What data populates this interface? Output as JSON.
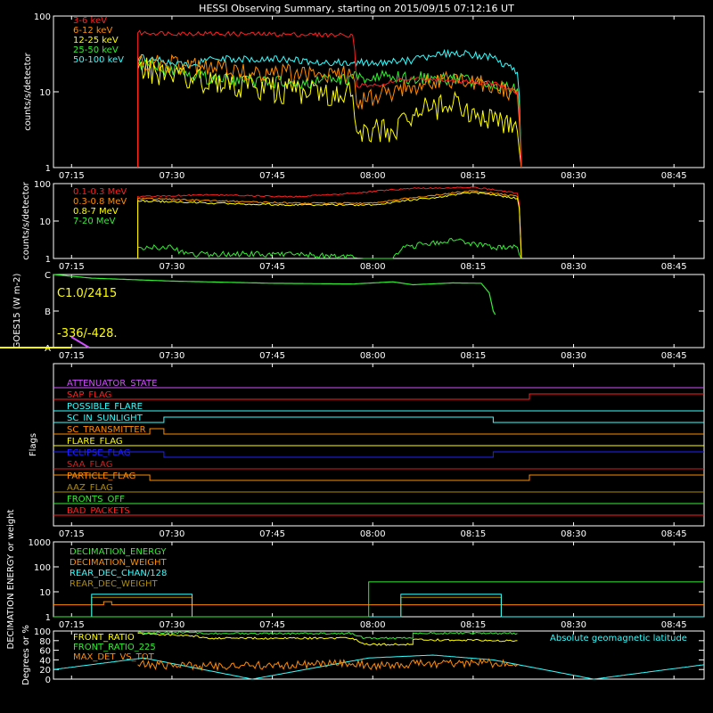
{
  "title": "HESSI Observing Summary, starting on 2015/09/15 07:12:16 UT",
  "time_ticks": [
    "07:15",
    "07:30",
    "07:45",
    "08:00",
    "08:15",
    "08:30",
    "08:45"
  ],
  "colors": {
    "red": "#ff2020",
    "orange": "#ff8c00",
    "yellow": "#ffff00",
    "green": "#33ee33",
    "cyan": "#33ffff",
    "blue": "#2020ff",
    "magenta": "#d050ff",
    "olive": "#b08c00",
    "darkred": "#d02020",
    "white": "#ffffff"
  },
  "chart_data": [
    {
      "type": "line",
      "ylabel": "counts/s/detector",
      "yscale": "log",
      "ylim": [
        1,
        100
      ],
      "yticks": [
        "1",
        "10",
        "100"
      ],
      "legend_placement": "top-left",
      "series": [
        {
          "name": "3-6 keV",
          "color": "red",
          "points": [
            [
              7.415,
              1
            ],
            [
              7.415,
              60
            ],
            [
              7.95,
              56
            ],
            [
              7.96,
              12
            ],
            [
              8.0,
              12
            ],
            [
              8.1,
              15
            ],
            [
              8.3,
              13
            ],
            [
              8.36,
              10
            ],
            [
              8.37,
              1
            ]
          ]
        },
        {
          "name": "6-12 keV",
          "color": "orange",
          "points": [
            [
              7.415,
              1
            ],
            [
              7.415,
              25
            ],
            [
              7.7,
              18
            ],
            [
              7.95,
              17
            ],
            [
              7.96,
              7
            ],
            [
              8.1,
              12
            ],
            [
              8.2,
              14
            ],
            [
              8.3,
              12
            ],
            [
              8.36,
              9
            ],
            [
              8.37,
              1
            ]
          ]
        },
        {
          "name": "12-25 keV",
          "color": "yellow",
          "points": [
            [
              7.415,
              1
            ],
            [
              7.415,
              20
            ],
            [
              7.6,
              13
            ],
            [
              7.8,
              10
            ],
            [
              7.95,
              9
            ],
            [
              7.96,
              3
            ],
            [
              8.05,
              3
            ],
            [
              8.1,
              5
            ],
            [
              8.2,
              7
            ],
            [
              8.3,
              4
            ],
            [
              8.36,
              3
            ],
            [
              8.37,
              1
            ]
          ]
        },
        {
          "name": "25-50 keV",
          "color": "green",
          "points": [
            [
              7.415,
              1
            ],
            [
              7.415,
              22
            ],
            [
              7.6,
              15
            ],
            [
              7.8,
              13
            ],
            [
              7.95,
              15
            ],
            [
              8.05,
              16
            ],
            [
              8.15,
              15
            ],
            [
              8.25,
              14
            ],
            [
              8.36,
              11
            ],
            [
              8.37,
              1
            ]
          ]
        },
        {
          "name": "50-100 keV",
          "color": "cyan",
          "points": [
            [
              7.415,
              1
            ],
            [
              7.415,
              28
            ],
            [
              7.55,
              22
            ],
            [
              7.6,
              28
            ],
            [
              7.8,
              26
            ],
            [
              7.95,
              24
            ],
            [
              8.1,
              26
            ],
            [
              8.2,
              33
            ],
            [
              8.3,
              28
            ],
            [
              8.36,
              18
            ],
            [
              8.37,
              1
            ]
          ]
        }
      ]
    },
    {
      "type": "line",
      "ylabel": "counts/s/detector",
      "yscale": "log",
      "ylim": [
        1,
        100
      ],
      "yticks": [
        "1",
        "10",
        "100"
      ],
      "legend_placement": "top-left",
      "series": [
        {
          "name": "0.1-0.3 MeV",
          "color": "red",
          "points": [
            [
              7.415,
              1
            ],
            [
              7.415,
              45
            ],
            [
              7.6,
              50
            ],
            [
              7.8,
              44
            ],
            [
              7.95,
              55
            ],
            [
              8.1,
              75
            ],
            [
              8.25,
              80
            ],
            [
              8.36,
              55
            ],
            [
              8.37,
              1
            ]
          ]
        },
        {
          "name": "0.3-0.8 MeV",
          "color": "orange",
          "points": [
            [
              7.415,
              1
            ],
            [
              7.415,
              40
            ],
            [
              7.6,
              35
            ],
            [
              7.8,
              30
            ],
            [
              8.0,
              30
            ],
            [
              8.15,
              48
            ],
            [
              8.25,
              65
            ],
            [
              8.36,
              45
            ],
            [
              8.37,
              1
            ]
          ]
        },
        {
          "name": "0.8-7 MeV",
          "color": "yellow",
          "points": [
            [
              7.415,
              1
            ],
            [
              7.415,
              35
            ],
            [
              7.6,
              30
            ],
            [
              7.8,
              27
            ],
            [
              8.0,
              27
            ],
            [
              8.15,
              42
            ],
            [
              8.25,
              58
            ],
            [
              8.36,
              40
            ],
            [
              8.37,
              1
            ]
          ]
        },
        {
          "name": "7-20 MeV",
          "color": "green",
          "points": [
            [
              7.415,
              1
            ],
            [
              7.415,
              2
            ],
            [
              7.5,
              2
            ],
            [
              7.53,
              1.3
            ],
            [
              7.8,
              1.3
            ],
            [
              7.98,
              1
            ],
            [
              8.05,
              1
            ],
            [
              8.08,
              2
            ],
            [
              8.2,
              3
            ],
            [
              8.3,
              2
            ],
            [
              8.36,
              2
            ],
            [
              8.37,
              1
            ]
          ]
        }
      ]
    },
    {
      "type": "line",
      "ylabel": "GOES15 (W m-2)",
      "yscale": "log",
      "yticks": [
        "A",
        "B",
        "C"
      ],
      "annotations": [
        "C1.0/2415",
        "-336/-428."
      ],
      "series": [
        {
          "name": "GOES15",
          "color": "green",
          "points": [
            [
              7.205,
              3.0
            ],
            [
              7.3,
              2.9
            ],
            [
              7.5,
              2.82
            ],
            [
              7.75,
              2.76
            ],
            [
              7.95,
              2.74
            ],
            [
              8.05,
              2.8
            ],
            [
              8.1,
              2.72
            ],
            [
              8.2,
              2.77
            ],
            [
              8.27,
              2.76
            ],
            [
              8.29,
              2.5
            ],
            [
              8.3,
              2.0
            ],
            [
              8.305,
              1.9
            ]
          ]
        }
      ]
    },
    {
      "type": "line",
      "ylabel": "Flags",
      "series": [
        {
          "name": "ATTENUATOR_STATE",
          "color": "magenta",
          "segments": [
            [
              7.205,
              8.825,
              0
            ]
          ]
        },
        {
          "name": "SAP_FLAG",
          "color": "red",
          "segments": [
            [
              7.205,
              8.39,
              0
            ],
            [
              8.39,
              8.825,
              1
            ]
          ]
        },
        {
          "name": "POSSIBLE_FLARE",
          "color": "cyan",
          "segments": [
            [
              7.205,
              8.825,
              0
            ]
          ]
        },
        {
          "name": "SC_IN_SUNLIGHT",
          "color": "cyan",
          "segments": [
            [
              7.205,
              7.48,
              0
            ],
            [
              7.48,
              8.3,
              1
            ],
            [
              8.3,
              8.825,
              0
            ]
          ]
        },
        {
          "name": "SC_TRANSMITTER",
          "color": "orange",
          "segments": [
            [
              7.205,
              7.445,
              0
            ],
            [
              7.445,
              7.48,
              1
            ],
            [
              7.48,
              8.825,
              0
            ]
          ]
        },
        {
          "name": "FLARE_FLAG",
          "color": "yellow",
          "segments": [
            [
              7.205,
              8.825,
              0
            ]
          ]
        },
        {
          "name": "ECLIPSE_FLAG",
          "color": "blue",
          "segments": [
            [
              7.205,
              7.48,
              1
            ],
            [
              7.48,
              8.3,
              0
            ],
            [
              8.3,
              8.825,
              1
            ]
          ]
        },
        {
          "name": "SAA_FLAG",
          "color": "darkred",
          "segments": [
            [
              7.205,
              8.825,
              0
            ]
          ]
        },
        {
          "name": "PARTICLE_FLAG",
          "color": "orange",
          "segments": [
            [
              7.205,
              7.445,
              1
            ],
            [
              7.445,
              8.39,
              0
            ],
            [
              8.39,
              8.825,
              1
            ]
          ]
        },
        {
          "name": "AAZ_FLAG",
          "color": "olive",
          "segments": [
            [
              7.205,
              8.825,
              0
            ]
          ]
        },
        {
          "name": "FRONTS_OFF",
          "color": "green",
          "segments": [
            [
              7.205,
              8.825,
              0
            ]
          ]
        },
        {
          "name": "BAD_PACKETS",
          "color": "red",
          "segments": [
            [
              7.205,
              8.825,
              0
            ]
          ]
        }
      ]
    },
    {
      "type": "line",
      "ylabel": "DECIMATION ENERGY or weight",
      "yscale": "log",
      "ylim": [
        1,
        1000
      ],
      "yticks": [
        "1",
        "10",
        "100",
        "1000"
      ],
      "legend_placement": "top-left",
      "series": [
        {
          "name": "DECIMATION_ENERGY",
          "color": "green",
          "points": [
            [
              7.205,
              1
            ],
            [
              7.99,
              1
            ],
            [
              7.99,
              25
            ],
            [
              8.825,
              25
            ]
          ]
        },
        {
          "name": "DECIMATION_WEIGHT",
          "color": "orange",
          "points": [
            [
              7.205,
              3
            ],
            [
              7.33,
              3
            ],
            [
              7.33,
              4
            ],
            [
              7.35,
              4
            ],
            [
              7.35,
              3
            ],
            [
              8.825,
              3
            ]
          ]
        },
        {
          "name": "REAR_DEC_CHAN/128",
          "color": "cyan",
          "points": [
            [
              7.205,
              1
            ],
            [
              7.3,
              1
            ],
            [
              7.3,
              8
            ],
            [
              7.55,
              8
            ],
            [
              7.55,
              1
            ],
            [
              8.07,
              1
            ],
            [
              8.07,
              8
            ],
            [
              8.32,
              8
            ],
            [
              8.32,
              1
            ],
            [
              8.825,
              1
            ]
          ]
        },
        {
          "name": "REAR_DEC_WEIGHT",
          "color": "olive",
          "points": [
            [
              7.205,
              1
            ],
            [
              7.3,
              1
            ],
            [
              7.3,
              6
            ],
            [
              7.55,
              6
            ],
            [
              7.55,
              1
            ],
            [
              8.07,
              1
            ],
            [
              8.07,
              6
            ],
            [
              8.32,
              6
            ],
            [
              8.32,
              1
            ],
            [
              8.825,
              1
            ]
          ]
        }
      ]
    },
    {
      "type": "line",
      "ylabel": "Degrees or %",
      "ylim": [
        0,
        100
      ],
      "yticks": [
        "0",
        "20",
        "40",
        "60",
        "80",
        "100"
      ],
      "legend_placement": "top-left",
      "annotations": [
        "Absolute geomagnetic latitude"
      ],
      "series": [
        {
          "name": "FRONT_RATIO",
          "color": "yellow",
          "points": [
            [
              7.415,
              95
            ],
            [
              7.55,
              90
            ],
            [
              7.6,
              85
            ],
            [
              7.95,
              85
            ],
            [
              7.98,
              72
            ],
            [
              8.1,
              72
            ],
            [
              8.1,
              82
            ],
            [
              8.36,
              80
            ]
          ]
        },
        {
          "name": "FRONT_RATIO_225",
          "color": "green",
          "points": [
            [
              7.415,
              97
            ],
            [
              7.55,
              97
            ],
            [
              7.6,
              95
            ],
            [
              7.95,
              95
            ],
            [
              7.98,
              85
            ],
            [
              8.1,
              85
            ],
            [
              8.1,
              96
            ],
            [
              8.36,
              95
            ]
          ]
        },
        {
          "name": "MAX_DET_VS_TOT",
          "color": "orange",
          "points": [
            [
              7.415,
              30
            ],
            [
              7.6,
              28
            ],
            [
              7.8,
              30
            ],
            [
              7.95,
              32
            ],
            [
              8.0,
              28
            ],
            [
              8.15,
              32
            ],
            [
              8.25,
              35
            ],
            [
              8.36,
              30
            ]
          ]
        },
        {
          "name": "Absolute geomagnetic latitude",
          "color": "cyan",
          "points": [
            [
              7.205,
              20
            ],
            [
              7.43,
              44
            ],
            [
              7.7,
              0
            ],
            [
              7.99,
              44
            ],
            [
              8.15,
              50
            ],
            [
              8.3,
              40
            ],
            [
              8.55,
              0
            ],
            [
              8.825,
              30
            ]
          ]
        }
      ]
    }
  ]
}
